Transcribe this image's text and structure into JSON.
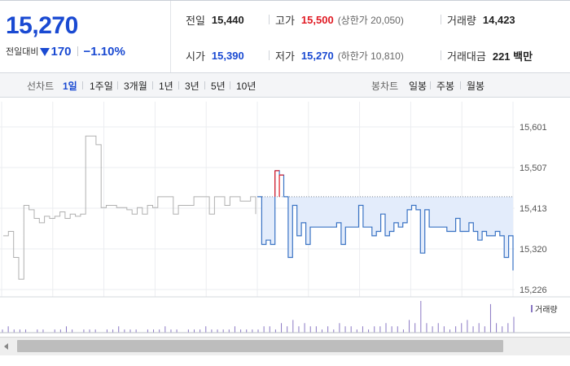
{
  "summary": {
    "current_price": "15,270",
    "change_label": "전일대비",
    "change_value": "170",
    "change_rate": "−1.10%",
    "stats": {
      "prev_close_label": "전일",
      "prev_close_value": "15,440",
      "high_label": "고가",
      "high_value": "15,500",
      "upper_limit": "(상한가 20,050)",
      "volume_label": "거래량",
      "volume_value": "14,423",
      "open_label": "시가",
      "open_value": "15,390",
      "low_label": "저가",
      "low_value": "15,270",
      "lower_limit": "(하한가 10,810)",
      "amount_label": "거래대금",
      "amount_value": "221 백만"
    }
  },
  "period_bar": {
    "line_label": "선차트",
    "line_options": [
      "1일",
      "1주일",
      "3개월",
      "1년",
      "3년",
      "5년",
      "10년"
    ],
    "active_option": "1일",
    "candle_label": "봉차트",
    "candle_options": [
      "일봉",
      "주봉",
      "월봉"
    ]
  },
  "colors": {
    "price_blue": "#1a4ad2",
    "price_red": "#e01a23",
    "prev_day_line": "#b0b0b0",
    "today_line": "#3a73c4",
    "today_fill": "#e3ecfb",
    "volume_bar": "#8a78c4"
  },
  "chart_data": {
    "type": "line",
    "y_ticks": [
      "15,601",
      "15,507",
      "15,413",
      "15,320",
      "15,226"
    ],
    "ylim": [
      15226,
      15601
    ],
    "reference_price": 15440,
    "series": [
      {
        "period": "previous day",
        "values": [
          15350,
          15360,
          15300,
          15250,
          15420,
          15410,
          15390,
          15380,
          15395,
          15390,
          15395,
          15405,
          15390,
          15400,
          15395,
          15400,
          15580,
          15580,
          15560,
          15415,
          15420,
          15420,
          15415,
          15415,
          15410,
          15400,
          15415,
          15400,
          15420,
          15415,
          15440,
          15440,
          15440,
          15400,
          15420,
          15420,
          15420,
          15440,
          15440,
          15440,
          15400,
          15440,
          15440,
          15420,
          15440,
          15440,
          15430,
          15430,
          15440,
          15400
        ]
      },
      {
        "period": "today",
        "values": [
          15440,
          15330,
          15340,
          15330,
          15500,
          15490,
          15440,
          15300,
          15420,
          15350,
          15380,
          15330,
          15370,
          15370,
          15370,
          15370,
          15370,
          15370,
          15380,
          15330,
          15370,
          15370,
          15370,
          15420,
          15370,
          15370,
          15350,
          15360,
          15400,
          15350,
          15360,
          15380,
          15370,
          15380,
          15410,
          15420,
          15410,
          15310,
          15410,
          15370,
          15370,
          15370,
          15370,
          15360,
          15360,
          15390,
          15360,
          15360,
          15380,
          15360,
          15340,
          15360,
          15350,
          15350,
          15360,
          15350,
          15300,
          15350,
          15270
        ]
      }
    ],
    "volume": {
      "label": "거래량",
      "values": [
        1,
        2,
        1,
        1,
        1,
        0,
        1,
        1,
        0,
        1,
        1,
        2,
        1,
        0,
        1,
        1,
        1,
        0,
        1,
        1,
        2,
        1,
        1,
        1,
        0,
        1,
        1,
        1,
        2,
        1,
        1,
        0,
        1,
        1,
        1,
        2,
        1,
        1,
        1,
        1,
        2,
        1,
        1,
        1,
        1,
        2,
        2,
        1,
        3,
        2,
        4,
        2,
        3,
        2,
        2,
        1,
        2,
        1,
        3,
        2,
        2,
        1,
        2,
        1,
        2,
        2,
        3,
        2,
        2,
        1,
        4,
        3,
        10,
        3,
        2,
        3,
        2,
        1,
        2,
        3,
        4,
        2,
        3,
        2,
        9,
        3,
        2,
        3,
        5
      ]
    }
  }
}
